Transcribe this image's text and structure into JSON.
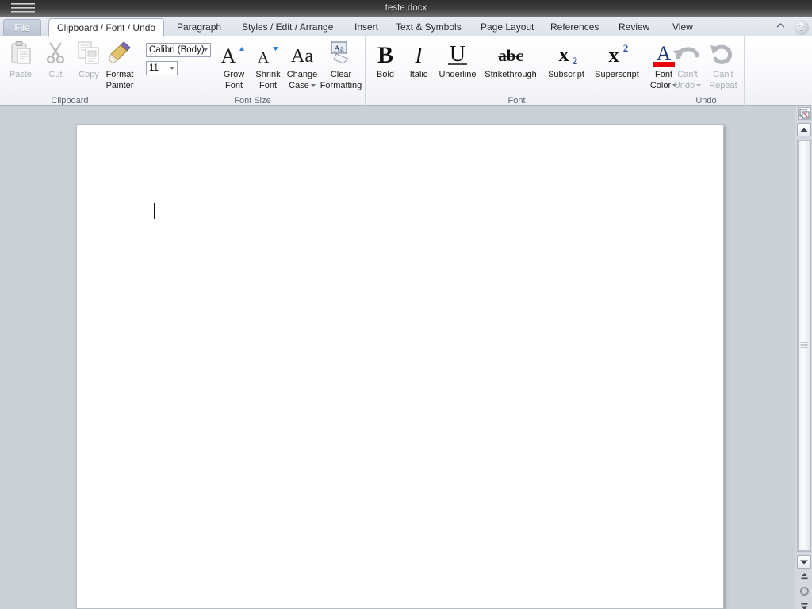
{
  "titlebar": {
    "title": "teste.docx",
    "window_menu_icon": "window-menu-icon"
  },
  "tabs": {
    "file_label": "File",
    "items": [
      {
        "label": "Clipboard / Font / Undo",
        "active": true
      },
      {
        "label": "Paragraph",
        "active": false
      },
      {
        "label": "Styles / Edit / Arrange",
        "active": false
      },
      {
        "label": "Insert",
        "active": false
      },
      {
        "label": "Text & Symbols",
        "active": false
      },
      {
        "label": "Page Layout",
        "active": false
      },
      {
        "label": "References",
        "active": false
      },
      {
        "label": "Review",
        "active": false
      },
      {
        "label": "View",
        "active": false
      }
    ],
    "collapse_icon": "chevron-up-icon",
    "help_icon": "help-icon",
    "help_glyph": "?"
  },
  "ribbon": {
    "groups": [
      {
        "name": "clipboard",
        "label": "Clipboard",
        "buttons": [
          {
            "label": "Paste",
            "icon": "paste-icon",
            "disabled": true
          },
          {
            "label": "Cut",
            "icon": "cut-icon",
            "disabled": true
          },
          {
            "label": "Copy",
            "icon": "copy-icon",
            "disabled": true
          },
          {
            "label": "Format Painter",
            "label_l1": "Format",
            "label_l2": "Painter",
            "icon": "format-painter-icon",
            "disabled": false
          }
        ]
      },
      {
        "name": "font-size",
        "label": "Font Size",
        "font_name_value": "Calibri (Body)",
        "font_size_value": "11",
        "buttons": [
          {
            "label_l1": "Grow",
            "label_l2": "Font",
            "icon": "grow-font-icon"
          },
          {
            "label_l1": "Shrink",
            "label_l2": "Font",
            "icon": "shrink-font-icon"
          },
          {
            "label_l1": "Change",
            "label_l2": "Case",
            "icon": "change-case-icon",
            "dropdown": true
          },
          {
            "label_l1": "Clear",
            "label_l2": "Formatting",
            "icon": "clear-formatting-icon"
          }
        ]
      },
      {
        "name": "font",
        "label": "Font",
        "buttons": [
          {
            "label": "Bold",
            "icon": "bold-icon",
            "glyph": "B"
          },
          {
            "label": "Italic",
            "icon": "italic-icon",
            "glyph": "I"
          },
          {
            "label": "Underline",
            "icon": "underline-icon",
            "glyph": "U"
          },
          {
            "label": "Strikethrough",
            "icon": "strikethrough-icon",
            "glyph": "abc"
          },
          {
            "label": "Subscript",
            "icon": "subscript-icon",
            "glyph": "x"
          },
          {
            "label": "Superscript",
            "icon": "superscript-icon",
            "glyph": "x"
          },
          {
            "label": "Font Color",
            "label_l1": "Font",
            "label_l2": "Color",
            "icon": "font-color-icon",
            "glyph": "A",
            "color": "#e8000d",
            "dropdown": true
          }
        ]
      },
      {
        "name": "undo",
        "label": "Undo",
        "buttons": [
          {
            "label_l1": "Can't",
            "label_l2": "Undo",
            "icon": "undo-icon",
            "disabled": true,
            "dropdown": true
          },
          {
            "label_l1": "Can't",
            "label_l2": "Repeat",
            "icon": "redo-icon",
            "disabled": true
          }
        ]
      }
    ]
  },
  "document": {
    "page_name": "document-page",
    "content": "",
    "caret_visible": true
  },
  "scrollbar": {
    "split_icon": "split-window-icon",
    "up_icon": "scroll-up-icon",
    "down_icon": "scroll-down-icon",
    "prev_page_icon": "previous-page-icon",
    "browse_object_icon": "select-browse-object-icon",
    "next_page_icon": "next-page-icon",
    "prev_glyph": "⥣",
    "next_glyph": "⥥"
  },
  "colors": {
    "window_bg": "#cbd0d6",
    "titlebar_dark": "#2e2e2e",
    "tabstrip": "#e3e6ee",
    "accent_red": "#e8000d",
    "page_white": "#ffffff"
  }
}
